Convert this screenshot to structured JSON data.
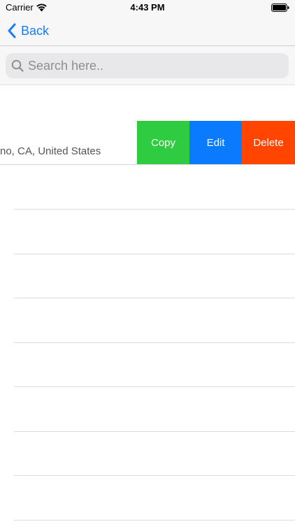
{
  "status_bar": {
    "carrier": "Carrier",
    "time": "4:43 PM",
    "wifi_icon": "wifi-icon",
    "battery_icon": "battery-icon"
  },
  "nav": {
    "back_label": "Back",
    "back_icon": "chevron-left-icon",
    "accent_color": "#147efb"
  },
  "search": {
    "placeholder": "Search here..",
    "value": "",
    "icon": "search-icon"
  },
  "list": {
    "rows": [
      {
        "subtitle": "no, CA, United States",
        "actions": [
          {
            "label": "Copy",
            "color": "#2ecc40"
          },
          {
            "label": "Edit",
            "color": "#0a7aff"
          },
          {
            "label": "Delete",
            "color": "#ff4500"
          }
        ]
      }
    ]
  }
}
